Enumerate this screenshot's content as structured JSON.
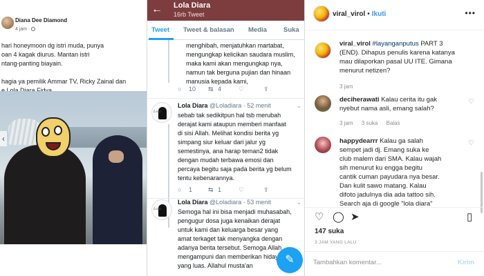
{
  "facebook": {
    "author": "Diana Dee Diamond",
    "time": "4 jam ·",
    "post_lines": [
      "hari honeymoon dg istri muda, punya",
      "oan 4 kagak diurus. Mantan istri",
      "ntang-panting biayain.",
      "",
      "hagia ya pemilik Ammar TV, Ricky Zainal dan",
      "e Lola Diara Fidya."
    ]
  },
  "twitter": {
    "title": "Lola Diara",
    "subtitle": "16rb Tweet",
    "tabs": [
      "Tweet",
      "Tweet & balasan",
      "Media",
      "Suka"
    ],
    "first_tweet_lines": [
      "menghibah, menjatuhkan martabat,",
      "mengungkap kelicikan saudara muslim,",
      "maka kami akan mengungkap nya,",
      "namun tak berguna pujian dan hinaan",
      "manusia kepada kami,"
    ],
    "first_actions": {
      "replies": "10",
      "retweets": "4"
    },
    "tweets": [
      {
        "name": "Lola Diara",
        "handle": "@Loladiara",
        "time": "· 52 menit",
        "lines": [
          "sebab tak sedikitpun hal tsb merubah",
          "derajat kami ataupun memberi manfaat",
          "di sisi Allah. Melihat kondisi berita yg",
          "simpang siur keluar dari jalur yg",
          "semestinya, ana harap teman2 tidak",
          "dengan mudah terbawa emosi dan",
          "percaya begitu saja pada berita yg belum",
          "tentu kebenarannya."
        ],
        "replies": "1",
        "retweets": "1"
      },
      {
        "name": "Lola Diara",
        "handle": "@Loladiara",
        "time": "· 53 menit",
        "lines": [
          "Semoga hal ini bisa menjadi muhasabah,",
          "pengugur dosa juga kenaikan derajat",
          "untuk kami dan keluarga besar yang",
          "amat terkaget tak menyangka dengan",
          "adanya berita tersebut. Semoga Allah",
          "mengampuni dan memberikan hidayah",
          "yang luas. Allahul musta'an"
        ]
      }
    ]
  },
  "instagram": {
    "username": "viral_virol",
    "follow": "Ikuti",
    "caption": {
      "user": "viral_virol",
      "hashtag": "#layanganputus",
      "lines": [
        " PART 3",
        "(END). Dihapus penulis karena katanya",
        "mau dilaporkan pasal UU ITE. Gimana",
        "menurut netizen?"
      ],
      "time": "3 jam"
    },
    "comments": [
      {
        "user": "deciherawati",
        "lines": [
          " Kalau cerita itu gak",
          "nyebut nama asli, emang salah?"
        ],
        "time": "3 jam",
        "likes": "3 suka",
        "reply": "Balas"
      },
      {
        "user": "happydearrr",
        "lines": [
          " Kalau ga salah",
          "sempet jadi dj. Emang suka ke",
          "club malem dari SMA. Kalau wajah",
          "sih menurut ku engga begitu",
          "cantik cuman payudara nya besar.",
          "Dan kulit sawo matang. Kalau",
          "difoto jadulnya dia ada tattoo sih.",
          "Search aja di google \"lola diara\""
        ]
      }
    ],
    "likes": "147 suka",
    "ago": "3 JAM YANG LALU",
    "comment_placeholder": "Tambahkan komentar...",
    "post_label": "Kirim"
  }
}
